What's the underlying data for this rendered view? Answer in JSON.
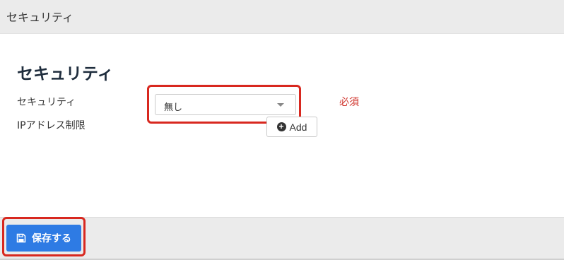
{
  "header": {
    "title": "セキュリティ"
  },
  "section": {
    "title": "セキュリティ"
  },
  "form": {
    "security_label": "セキュリティ",
    "security_value": "無し",
    "required_label": "必須",
    "ip_restriction_label": "IPアドレス制限",
    "add_button_label": "Add"
  },
  "footer": {
    "save_button_label": "保存する"
  },
  "icons": {
    "add": "plus-circle-icon",
    "save": "floppy-disk-icon",
    "dropdown": "caret-down-icon"
  },
  "colors": {
    "primary": "#2e7be4",
    "required": "#d0342c",
    "highlight": "#d8281f"
  }
}
